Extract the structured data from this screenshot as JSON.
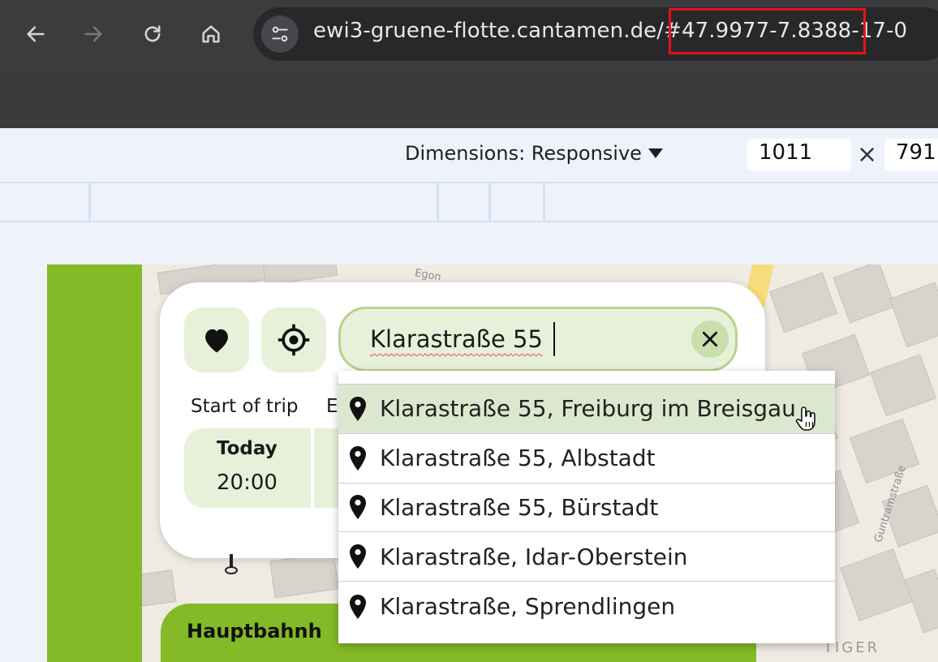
{
  "browser": {
    "url_host": "ewi3-gruene-flotte.cantamen.de/",
    "url_fragment": "#47.9977-7.8388",
    "url_tail": "-17-0",
    "icons": [
      "back-arrow-icon",
      "forward-arrow-icon",
      "reload-icon",
      "home-icon",
      "site-settings-icon"
    ]
  },
  "devtools": {
    "dimensions_label": "Dimensions: Responsive",
    "width": "1011",
    "times": "×",
    "height": "791"
  },
  "app": {
    "search_value": "Klarastraße 55",
    "start_label": "Start of trip",
    "end_label": "E",
    "start_day": "Today",
    "start_time": "20:00",
    "station_title": "Hauptbahnh",
    "suggestions": [
      "Klarastraße 55, Freiburg im Breisgau",
      "Klarastraße 55, Albstadt",
      "Klarastraße 55, Bürstadt",
      "Klarastraße, Idar-Oberstein",
      "Klarastraße, Sprendlingen"
    ],
    "map_labels": [
      "Egon",
      "Guntramstraße",
      "TIGER"
    ],
    "colors": {
      "brand_green": "#84ba27",
      "light_green": "#e7f1da",
      "highlight_red": "#e0141b"
    }
  }
}
